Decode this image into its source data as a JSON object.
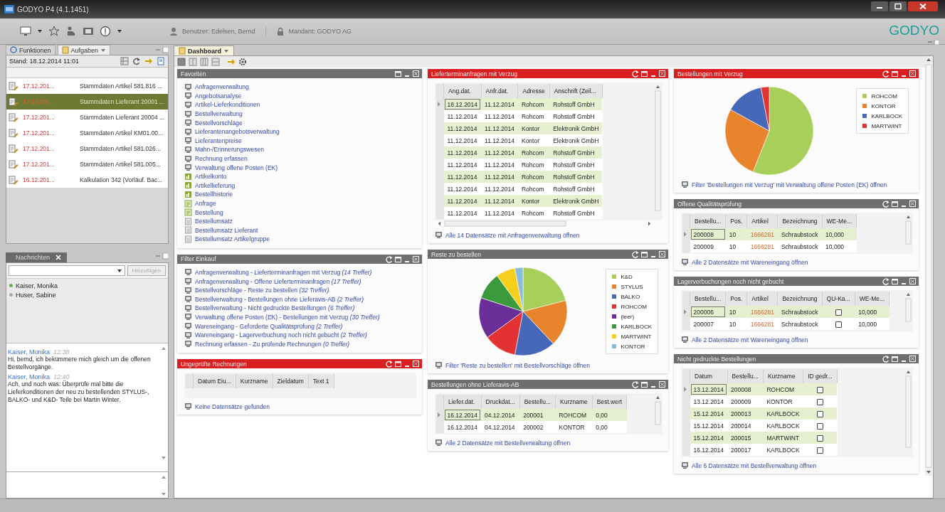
{
  "window": {
    "title": "GODYO P4 (4.1.1451)"
  },
  "toolbar": {
    "user": "Benutzer: Edelsen, Bernd",
    "client": "Mandant: GODYO AG",
    "logo": "GODYO"
  },
  "left_tabs": [
    {
      "label": "Funktionen",
      "selected": false
    },
    {
      "label": "Aufgaben",
      "selected": true
    }
  ],
  "tasks": {
    "stand": "Stand: 18.12.2014 11:01",
    "rows": [
      {
        "date": "17.12.201...",
        "text": "Stammdaten Artikel 581.816 ...",
        "selected": false
      },
      {
        "date": "17.12.201...",
        "text": "Stammdaten Lieferant 20001 ...",
        "selected": true
      },
      {
        "date": "17.12.201...",
        "text": "Stammdaten Lieferant 20004 ...",
        "selected": false
      },
      {
        "date": "17.12.201...",
        "text": "Stammdaten Artikel KM01.00...",
        "selected": false
      },
      {
        "date": "17.12.201...",
        "text": "Stammdaten Artikel 581.026...",
        "selected": false
      },
      {
        "date": "17.12.201...",
        "text": "Stammdaten Artikel 581.005...",
        "selected": false
      },
      {
        "date": "16.12.201...",
        "text": "Kalkulation 342 (Vorläuf. Bac...",
        "selected": false
      }
    ]
  },
  "messages_panel": {
    "tab": "Nachrichten",
    "button": {
      "label": "Hinzufügen",
      "disabled": true
    },
    "users": [
      {
        "name": "Kaiser, Monika",
        "online": true
      },
      {
        "name": "Huser, Sabine",
        "online": false
      }
    ],
    "messages": [
      {
        "sender": "Kaiser, Monika",
        "time": "12:38",
        "text": "Hi, bernd, ich bekümmere mich gleich um die offenen Bestellvorgänge."
      },
      {
        "sender": "Kaiser, Monika",
        "time": "12:40",
        "text": "Ach, und noch was: Überprüfe mal bitte die Lieferkonditionen der neu zu bestellenden STYLUS-, BALKO- und K&D- Teile bei Martin Winter."
      }
    ]
  },
  "main_tabs": [
    {
      "label": "Dashboard",
      "selected": true
    }
  ],
  "columns": [
    [
      {
        "kind": "links",
        "title": "Favoriten",
        "alert": false,
        "items": [
          {
            "label": "Anfragenverwaltung",
            "kind": "app"
          },
          {
            "label": "Angebotsanalyse",
            "kind": "app"
          },
          {
            "label": "Artikel-Lieferkonditionen",
            "kind": "app"
          },
          {
            "label": "Bestellverwaltung",
            "kind": "app"
          },
          {
            "label": "Bestellvorschläge",
            "kind": "app"
          },
          {
            "label": "Lieferantenangebotsverwaltung",
            "kind": "app"
          },
          {
            "label": "Lieferantenpreise",
            "kind": "app"
          },
          {
            "label": "Mahn-/Erinnerungswesen",
            "kind": "app"
          },
          {
            "label": "Rechnung erfassen",
            "kind": "app"
          },
          {
            "label": "Verwaltung offene Posten (EK)",
            "kind": "app"
          },
          {
            "label": "Artikelkonto",
            "kind": "info"
          },
          {
            "label": "Artikellieferung",
            "kind": "info"
          },
          {
            "label": "Bestellhistorie",
            "kind": "info"
          },
          {
            "label": "Anfrage",
            "kind": "form"
          },
          {
            "label": "Bestellung",
            "kind": "form"
          },
          {
            "label": "Bestellumsatz",
            "kind": "report"
          },
          {
            "label": "Bestellumsatz Lieferant",
            "kind": "report"
          },
          {
            "label": "Bestellumsatz Artikelgruppe",
            "kind": "report"
          }
        ]
      },
      {
        "kind": "links",
        "title": "Filter Einkauf",
        "alert": false,
        "items": [
          {
            "label": "Anfragenverwaltung - Lieferterminanfragen mit Verzug *(14 Treffer)*",
            "kind": "app"
          },
          {
            "label": "Anfragenverwaltung - Offene Lieferterminanfragen *(17 Treffer)*",
            "kind": "app"
          },
          {
            "label": "Bestellvorschläge - Reste zu bestellen *(32 Treffer)*",
            "kind": "app"
          },
          {
            "label": "Bestellverwaltung - Bestellungen ohne Lieferavis-AB *(2 Treffer)*",
            "kind": "app"
          },
          {
            "label": "Bestellverwaltung - Nicht gedruckte Bestellungen *(6 Treffer)*",
            "kind": "app"
          },
          {
            "label": "Verwaltung offene Posten (EK) - Bestellungen mit Verzug *(30 Treffer)*",
            "kind": "app"
          },
          {
            "label": "Wareneingang - Geforderte Qualitätsprüfung *(2 Treffer)*",
            "kind": "app"
          },
          {
            "label": "Wareneingang - Lagerverbuchung noch nicht gebucht *(2 Treffer)*",
            "kind": "app"
          },
          {
            "label": "Rechnung erfassen - Zu prüfende Rechnungen *(0 Treffer)*",
            "kind": "app"
          }
        ]
      },
      {
        "kind": "table",
        "title": "Ungeprüfte Rechnungen",
        "alert": true,
        "columns": [
          {
            "label": "Datum Eiu..."
          },
          {
            "label": "Kurzname"
          },
          {
            "label": "Zieldatum"
          },
          {
            "label": "Text 1"
          }
        ],
        "footer": "Keine Datensätze gefunden"
      }
    ],
    [
      {
        "kind": "table",
        "title": "Lieferterminanfragen mit Verzug",
        "alert": true,
        "columns": [
          {
            "label": "Ang.dat."
          },
          {
            "label": "Anfr.dat."
          },
          {
            "label": "Adresse"
          },
          {
            "label": "Anschrift (Zeil..."
          }
        ],
        "rows": [
          {
            "selected": true,
            "cells": [
              "18.12.2014",
              "11.12.2014",
              "Rohcom",
              "Rohstoff GmbH"
            ]
          },
          {
            "selected": false,
            "cells": [
              "11.12.2014",
              "11.12.2014",
              "Rohcom",
              "Rohstoff GmbH"
            ]
          },
          {
            "selected": false,
            "cells": [
              "11.12.2014",
              "11.12.2014",
              "Kontor",
              "Elektronik GmbH"
            ]
          },
          {
            "selected": false,
            "cells": [
              "11.12.2014",
              "11.12.2014",
              "Kontor",
              "Elektronik GmbH"
            ]
          },
          {
            "selected": false,
            "cells": [
              "11.12.2014",
              "11.12.2014",
              "Rohcom",
              "Rohstoff GmbH"
            ]
          },
          {
            "selected": false,
            "cells": [
              "11.12.2014",
              "11.12.2014",
              "Rohcom",
              "Rohstoff GmbH"
            ]
          },
          {
            "selected": false,
            "cells": [
              "11.12.2014",
              "11.12.2014",
              "Rohcom",
              "Rohstoff GmbH"
            ]
          },
          {
            "selected": false,
            "cells": [
              "11.12.2014",
              "11.12.2014",
              "Rohcom",
              "Rohstoff GmbH"
            ]
          },
          {
            "selected": false,
            "cells": [
              "11.12.2014",
              "11.12.2014",
              "Kontor",
              "Elektronik GmbH"
            ]
          },
          {
            "selected": false,
            "cells": [
              "11.12.2014",
              "11.12.2014",
              "Rohcom",
              "Rohstoff GmbH"
            ]
          }
        ],
        "footer": "Alle 14 Datensätze mit Anfragenverwaltung öffnen"
      },
      {
        "kind": "pie",
        "title": "Reste zu bestellen",
        "alert": false,
        "legend": [
          {
            "label": "K&D",
            "color": "#a9cf5b"
          },
          {
            "label": "STYLUS",
            "color": "#e8842b"
          },
          {
            "label": "BALKO",
            "color": "#4767b8"
          },
          {
            "label": "ROHCOM",
            "color": "#e23232"
          },
          {
            "label": "(leer)",
            "color": "#6b2e98"
          },
          {
            "label": "KARLBOCK",
            "color": "#3b9a3b"
          },
          {
            "label": "MARTWINT",
            "color": "#f5cf1b"
          },
          {
            "label": "KONTOR",
            "color": "#89bbdb"
          }
        ],
        "footer": "Filter 'Reste zu bestellen' mit Bestellvorschläge öffnen"
      },
      {
        "kind": "table",
        "title": "Bestellungen ohne Lieferavis-AB",
        "alert": false,
        "columns": [
          {
            "label": "Liefer.dat."
          },
          {
            "label": "Druckdat..."
          },
          {
            "label": "Bestellu..."
          },
          {
            "label": "Kurzname"
          },
          {
            "label": "Best.wert"
          }
        ],
        "rows": [
          {
            "selected": true,
            "cells": [
              "16.12.2014",
              "04.12.2014",
              "200001",
              "ROHCOM",
              "0,00"
            ]
          },
          {
            "selected": false,
            "cells": [
              "16.12.2014",
              "04.12.2014",
              "200002",
              "KONTOR",
              "0,00"
            ]
          }
        ],
        "footer": "Alle 2 Datensätze mit Bestellverwaltung öffnen"
      }
    ],
    [
      {
        "kind": "pie",
        "title": "Bestellungen mit Verzug",
        "alert": true,
        "legend": [
          {
            "label": "ROHCOM",
            "color": "#a9cf5b"
          },
          {
            "label": "KONTOR",
            "color": "#e8842b"
          },
          {
            "label": "KARLBOCK",
            "color": "#4767b8"
          },
          {
            "label": "MARTWINT",
            "color": "#e23232"
          }
        ],
        "footer": "Filter 'Bestellungen mit Verzug' mit Verwaltung offene Posten (EK) öffnen"
      },
      {
        "kind": "table",
        "title": "Offene Qualitätsprüfung",
        "alert": false,
        "columns": [
          {
            "label": "Bestellu..."
          },
          {
            "label": "Pos."
          },
          {
            "label": "Artikel",
            "link": true
          },
          {
            "label": "Bezeichnung"
          },
          {
            "label": "WE-Me..."
          }
        ],
        "rows": [
          {
            "selected": true,
            "cells": [
              "200008",
              "10",
              "1666281",
              "Schraubstock",
              "10,000"
            ]
          },
          {
            "selected": false,
            "cells": [
              "200009",
              "10",
              "1666281",
              "Schraubstock",
              "10,000"
            ]
          }
        ],
        "footer": "Alle 2 Datensätze mit Wareneingang öffnen"
      },
      {
        "kind": "table",
        "title": "Lagerverbuchungen noch nicht gebucht",
        "alert": false,
        "columns": [
          {
            "label": "Bestellu..."
          },
          {
            "label": "Pos."
          },
          {
            "label": "Artikel",
            "link": true
          },
          {
            "label": "Bezeichnung"
          },
          {
            "label": "QU-Ka..."
          },
          {
            "label": "WE-Me..."
          }
        ],
        "rows": [
          {
            "selected": true,
            "cells": [
              "200006",
              "10",
              "1666281",
              "Schraubstock",
              {
                "checked": false
              },
              "10,000"
            ]
          },
          {
            "selected": false,
            "cells": [
              "200007",
              "10",
              "1666281",
              "Schraubstock",
              {
                "checked": false
              },
              "10,000"
            ]
          }
        ],
        "footer": "Alle 2 Datensätze mit Wareneingang öffnen"
      },
      {
        "kind": "table",
        "title": "Nicht gedruckte Bestellungen",
        "alert": false,
        "columns": [
          {
            "label": "Datum"
          },
          {
            "label": "Bestellu..."
          },
          {
            "label": "Kurzname"
          },
          {
            "label": "ID gedr..."
          }
        ],
        "rows": [
          {
            "selected": true,
            "cells": [
              "13.12.2014",
              "200008",
              "ROHCOM",
              {
                "checked": false
              }
            ]
          },
          {
            "selected": false,
            "cells": [
              "13.12.2014",
              "200009",
              "KONTOR",
              {
                "checked": false
              }
            ]
          },
          {
            "selected": false,
            "cells": [
              "15.12.2014",
              "200013",
              "KARLBOCK",
              {
                "checked": false
              }
            ]
          },
          {
            "selected": false,
            "cells": [
              "15.12.2014",
              "200014",
              "KARLBOCK",
              {
                "checked": false
              }
            ]
          },
          {
            "selected": false,
            "cells": [
              "15.12.2014",
              "200015",
              "MARTWINT",
              {
                "checked": false
              }
            ]
          },
          {
            "selected": false,
            "cells": [
              "16.12.2014",
              "200017",
              "KARLBOCK",
              {
                "checked": false
              }
            ]
          }
        ],
        "footer": "Alle 6 Datensätze mit Bestellverwaltung öffnen"
      }
    ]
  ]
}
